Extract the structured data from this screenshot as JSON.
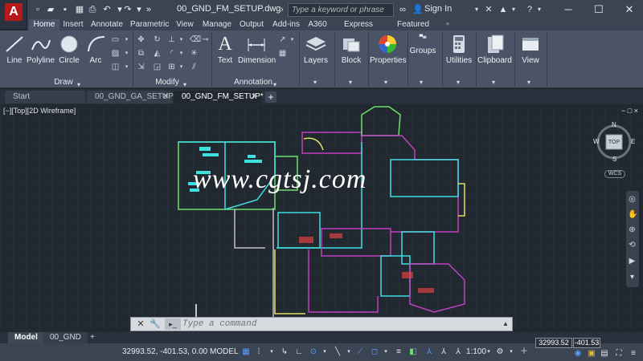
{
  "app": {
    "logo_letter": "A",
    "doc_title": "00_GND_FM_SETUP.dwg"
  },
  "search": {
    "placeholder": "Type a keyword or phrase"
  },
  "account": {
    "signin_label": "Sign In"
  },
  "ribbon_tabs": [
    "Home",
    "Insert",
    "Annotate",
    "Parametric",
    "View",
    "Manage",
    "Output",
    "Add-ins",
    "A360",
    "Express Tools",
    "Featured Apps"
  ],
  "draw_panel": {
    "line": "Line",
    "polyline": "Polyline",
    "circle": "Circle",
    "arc": "Arc",
    "label": "Draw"
  },
  "modify_panel": {
    "label": "Modify"
  },
  "annotation_panel": {
    "text": "Text",
    "dimension": "Dimension",
    "label": "Annotation"
  },
  "big_buttons": {
    "layers": "Layers",
    "block": "Block",
    "properties": "Properties",
    "groups": "Groups",
    "utilities": "Utilities",
    "clipboard": "Clipboard",
    "view": "View"
  },
  "file_tabs": {
    "start": "Start",
    "tab1": "00_GND_GA_SETUP*",
    "tab2": "00_GND_FM_SETUP*",
    "add": "+"
  },
  "viewport": {
    "label": "[−][Top][2D Wireframe]",
    "window_controls": "− □ ×"
  },
  "viewcube": {
    "north": "N",
    "south": "S",
    "east": "E",
    "west": "W",
    "top": "TOP",
    "wcs": "WCS"
  },
  "watermark": "www.cgtsj.com",
  "command": {
    "placeholder": "Type a command"
  },
  "layout_tabs": {
    "model": "Model",
    "layout": "00_GND",
    "add": "+"
  },
  "status": {
    "coords": "32993.52, -401.53, 0.00",
    "model": "MODEL",
    "scale": "1:100",
    "tip_x": "32993.52",
    "tip_y": "-401.53"
  },
  "colors": {
    "accent": "#b31b1b",
    "canvas": "#212830",
    "ribbon": "#4a5466",
    "cyan": "#3fe0e0",
    "magenta": "#c040c0",
    "green": "#6ee06e",
    "yellow": "#e0e060"
  }
}
